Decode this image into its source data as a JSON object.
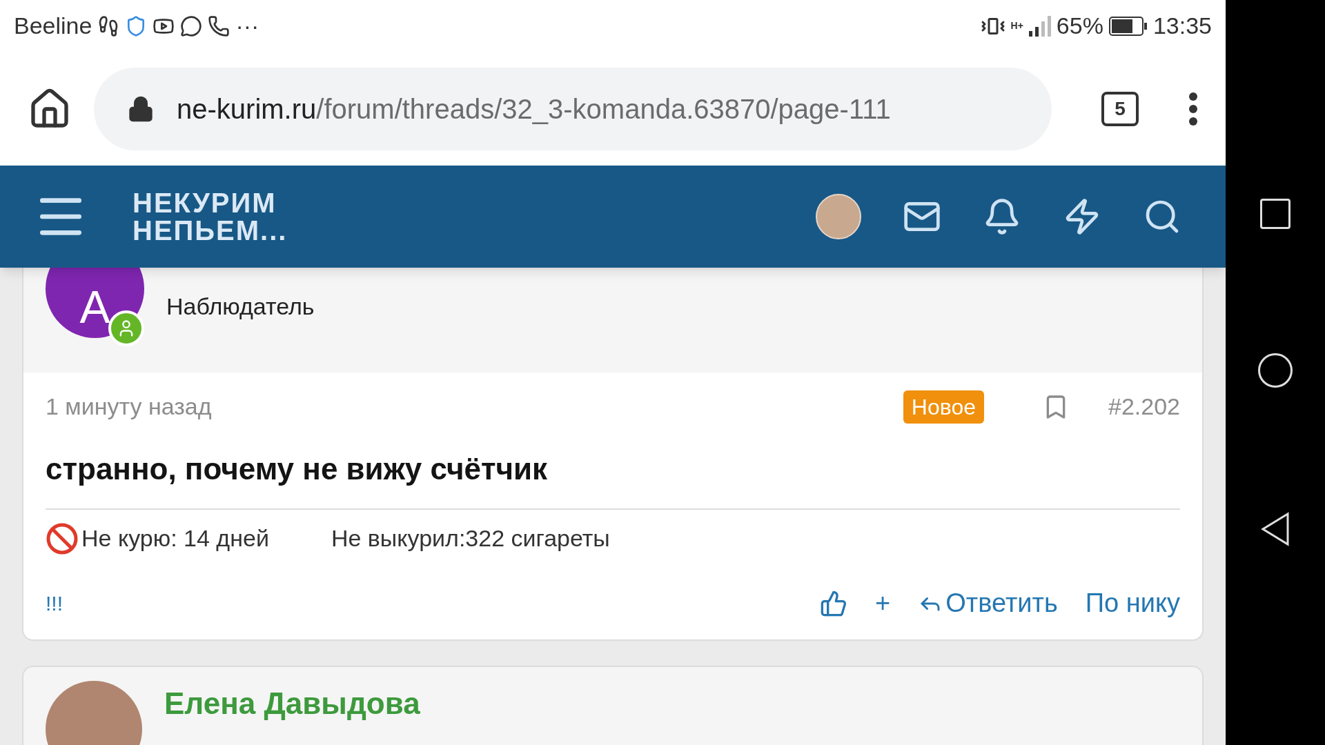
{
  "status_bar": {
    "carrier": "Beeline",
    "more": "···",
    "network": "H+",
    "battery": "65%",
    "time": "13:35"
  },
  "browser": {
    "url_domain": "ne-kurim.ru",
    "url_path": "/forum/threads/32_3-komanda.63870/page-111",
    "tab_count": "5"
  },
  "site_header": {
    "logo_lines": [
      "НЕКУРИМ",
      "НЕПЬЕМ..."
    ]
  },
  "post": {
    "avatar_letter": "A",
    "author_role": "Наблюдатель",
    "time": "1 минуту назад",
    "badge": "Новое",
    "number": "#2.202",
    "text": "странно, почему не вижу счётчик",
    "signature": [
      "Не курю: 14 дней",
      "Не выкурил:322 сигареты"
    ],
    "left_actions": [
      {
        "kind": "link",
        "label": "!!!"
      }
    ],
    "right_actions": [
      {
        "kind": "like"
      },
      {
        "kind": "text",
        "label": "+"
      },
      {
        "kind": "reply",
        "label": "Ответить"
      },
      {
        "kind": "text",
        "label": "По нику"
      }
    ]
  },
  "next_post": {
    "author_name": "Елена Давыдова"
  }
}
